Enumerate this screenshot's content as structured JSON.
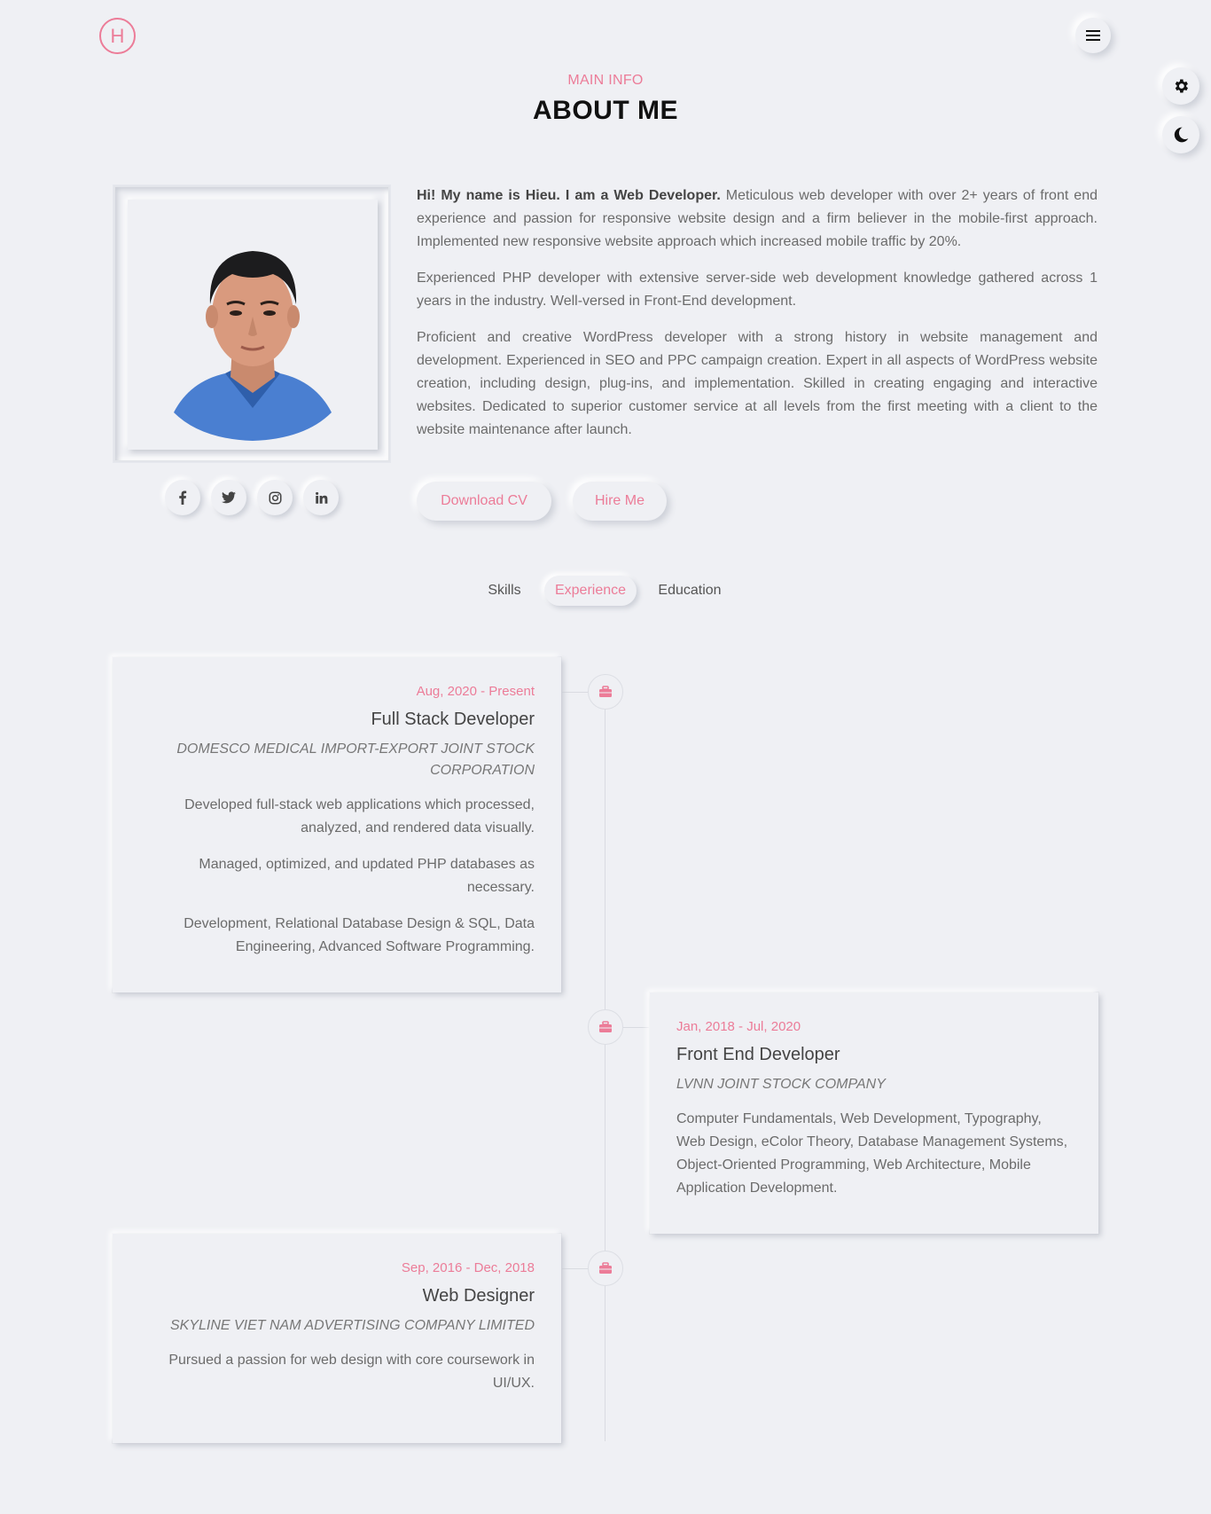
{
  "header": {
    "logo_letter": "H",
    "menu_icon": "hamburger-menu-icon",
    "settings_icon": "gear-icon",
    "theme_icon": "moon-icon"
  },
  "section": {
    "subtitle": "MAIN INFO",
    "title": "ABOUT ME"
  },
  "about": {
    "intro_bold": "Hi! My name is Hieu. I am a Web Developer.",
    "intro_rest": " Meticulous web developer with over 2+ years of front end experience and passion for responsive website design and a firm believer in the mobile-first approach. Implemented new responsive website approach which increased mobile traffic by 20%.",
    "paragraph2": "Experienced PHP developer with extensive server-side web development knowledge gathered across 1 years in the industry. Well-versed in Front-End development.",
    "paragraph3": "Proficient and creative WordPress developer with a strong history in website management and development. Experienced in SEO and PPC campaign creation. Expert in all aspects of WordPress website creation, including design, plug-ins, and implementation. Skilled in creating engaging and interactive websites. Dedicated to superior customer service at all levels from the first meeting with a client to the website maintenance after launch.",
    "download_cv": "Download CV",
    "hire_me": "Hire Me"
  },
  "social": [
    {
      "icon": "facebook-icon",
      "glyph": "f"
    },
    {
      "icon": "twitter-icon",
      "glyph": "t"
    },
    {
      "icon": "instagram-icon",
      "glyph": "ig"
    },
    {
      "icon": "linkedin-icon",
      "glyph": "in"
    }
  ],
  "tabs": {
    "skills": "Skills",
    "experience": "Experience",
    "education": "Education",
    "active": "Experience"
  },
  "experience": [
    {
      "date": "Aug, 2020 - Present",
      "role": "Full Stack Developer",
      "company": "DOMESCO MEDICAL IMPORT-EXPORT JOINT STOCK CORPORATION",
      "desc": [
        "Developed full-stack web applications which processed, analyzed, and rendered data visually.",
        "Managed, optimized, and updated PHP databases as necessary.",
        "Development, Relational Database Design & SQL, Data Engineering, Advanced Software Programming."
      ]
    },
    {
      "date": "Jan, 2018 - Jul, 2020",
      "role": "Front End Developer",
      "company": "LVNN JOINT STOCK COMPANY",
      "desc": [
        "Computer Fundamentals, Web Development, Typography, Web Design, eColor Theory, Database Management Systems, Object-Oriented Programming, Web Architecture, Mobile Application Development."
      ]
    },
    {
      "date": "Sep, 2016 - Dec, 2018",
      "role": "Web Designer",
      "company": "SKYLINE VIET NAM ADVERTISING COMPANY LIMITED",
      "desc": [
        "Pursued a passion for web design with core coursework in UI/UX."
      ]
    }
  ],
  "colors": {
    "accent": "#ec7c98",
    "background": "#eff0f4",
    "text": "#6b6b6b"
  }
}
